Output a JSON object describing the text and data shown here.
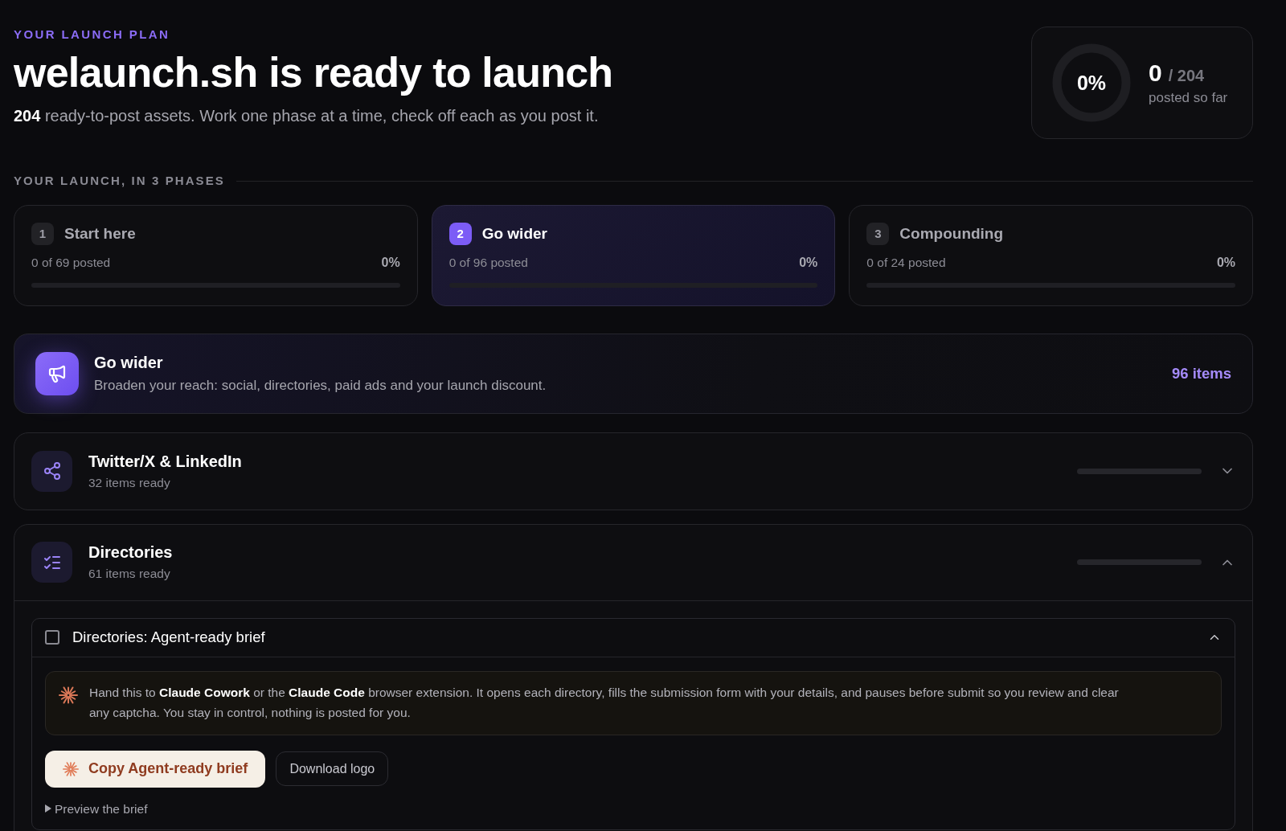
{
  "header": {
    "eyebrow": "YOUR LAUNCH PLAN",
    "title": "welaunch.sh is ready to launch",
    "subtitle": "**204** ready-to-post assets. Work one phase at a time, check off each as you post it."
  },
  "overall": {
    "percent": "0%",
    "level": 0,
    "posted": "0",
    "total": "/ 204",
    "caption": "posted so far"
  },
  "phases_heading": "YOUR LAUNCH, IN 3 PHASES",
  "phases": [
    {
      "number": "1",
      "name": "Start here",
      "count": "0 of 69 posted",
      "percent": "0%",
      "level": 0,
      "selected": false
    },
    {
      "number": "2",
      "name": "Go wider",
      "count": "0 of 96 posted",
      "percent": "0%",
      "level": 0,
      "selected": true
    },
    {
      "number": "3",
      "name": "Compounding",
      "count": "0 of 24 posted",
      "percent": "0%",
      "level": 0,
      "selected": false
    }
  ],
  "current_phase": {
    "title": "Go wider",
    "description": "Broaden your reach: social, directories, paid ads and your launch discount.",
    "count": "96 items"
  },
  "sections": [
    {
      "title": "Twitter/X & LinkedIn",
      "count": "32 items ready",
      "level": 0,
      "expanded": false
    },
    {
      "title": "Directories",
      "count": "61 items ready",
      "level": 0,
      "expanded": true,
      "items": [
        {
          "title": "Directories: Agent-ready brief",
          "checked": false,
          "expanded": true,
          "note": "Hand this to **Claude Cowork** or the **Claude Code** browser extension. It opens each directory, fills the submission form with your details, and pauses before submit so you review and clear any captcha. You stay in control, nothing is posted for you.",
          "buttons": [
            {
              "label": "Copy Agent-ready brief",
              "kind": "primary"
            },
            {
              "label": "Download logo",
              "kind": "secondary"
            }
          ],
          "preview": "Preview the brief"
        }
      ]
    }
  ]
}
